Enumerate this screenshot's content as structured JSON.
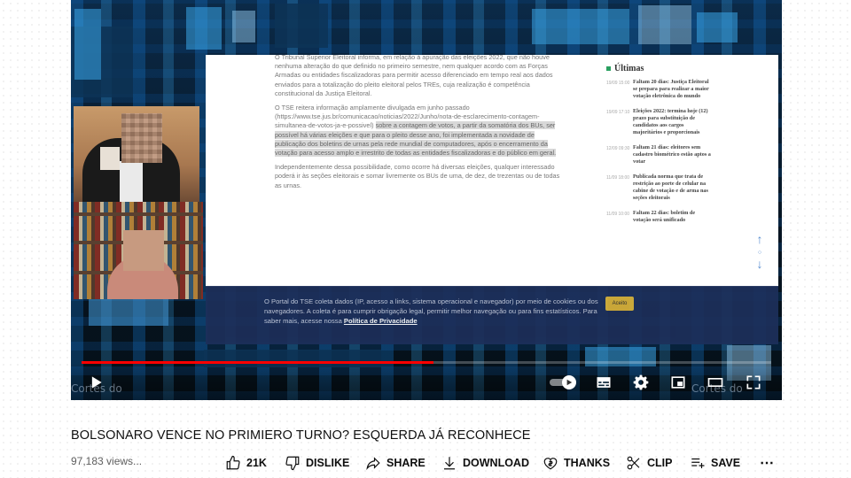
{
  "video": {
    "article": {
      "paragraph1": "O Tribunal Superior Eleitoral informa, em relação à apuração das eleições 2022, que não houve nenhuma alteração do que definido no primeiro semestre, nem qualquer acordo com as Forças Armadas ou entidades fiscalizadoras para permitir acesso diferenciado em tempo real aos dados enviados para a totalização do pleito eleitoral pelos TREs, cuja realização é competência constitucional da Justiça Eleitoral.",
      "paragraph2_plain": "O TSE reitera informação amplamente divulgada em junho passado (https://www.tse.jus.br/comunicacao/noticias/2022/Junho/nota-de-esclarecimento-contagem-simultanea-de-votos-ja-e-possivel) ",
      "paragraph2_highlight": "sobre a contagem de votos, a partir da somatória dos BUs, ser possível há várias eleições e que para o pleito desse ano, foi implementada a novidade de publicação dos boletins de urnas pela rede mundial de computadores, após o encerramento da votação para acesso amplo e irrestrito de todas as entidades fiscalizadoras e do público em geral.",
      "paragraph3": "Independentemente dessa possibilidade, como ocorre há diversas eleições, qualquer interessado poderá ir às seções eleitorais e somar livremente os BUs de uma, de dez, de trezentas ou de todas as urnas.",
      "sidebar_title": "Últimas",
      "news": [
        {
          "time": "19/09 15:00",
          "text": "Faltam 20 dias: Justiça Eleitoral se prepara para realizar a maior votação eletrônica do mundo"
        },
        {
          "time": "19/09 17:10",
          "text": "Eleições 2022: termina hoje (12) prazo para substituição de candidatos aos cargos majoritários e proporcionais"
        },
        {
          "time": "12/09 09:30",
          "text": "Faltam 21 dias: eleitores sem cadastro biométrico estão aptos a votar"
        },
        {
          "time": "11/09 18:00",
          "text": "Publicada norma que trata de restrição ao porte de celular na cabine de votação e de arma nas seções eleitorais"
        },
        {
          "time": "11/09 10:00",
          "text": "Faltam 22 dias: boletim de votação será unificado"
        }
      ],
      "cookie_text": "O Portal do TSE coleta dados (IP, acesso a links, sistema operacional e navegador) por meio de cookies ou dos navegadores. A coleta é para cumprir obrigação legal, permitir melhor navegação ou para fins estatísticos. Para saber mais, acesse nossa ",
      "cookie_link": "Política de Privacidade",
      "cookie_button": "Aceito"
    },
    "watermark_left": "Cortes do",
    "watermark_right": "Cortes do",
    "progress": {
      "played": 0.51,
      "buffered": 0.51
    }
  },
  "icons": {
    "play": "play-icon",
    "autoplay": "autoplay-toggle",
    "subtitles": "subtitles-icon",
    "settings": "gear-icon",
    "miniplayer": "miniplayer-icon",
    "theater": "theater-mode-icon",
    "fullscreen": "fullscreen-icon"
  },
  "title": "BOLSONARO VENCE NO PRIMIERO TURNO? ESQUERDA JÁ RECONHECE",
  "views": "97,183 views...",
  "actions": {
    "like": "21K",
    "dislike": "DISLIKE",
    "share": "SHARE",
    "download": "DOWNLOAD",
    "thanks": "THANKS",
    "clip": "CLIP",
    "save": "SAVE"
  },
  "colors": {
    "progress_red": "#ff0000",
    "text_primary": "#0f0f0f",
    "text_secondary": "#606060"
  }
}
